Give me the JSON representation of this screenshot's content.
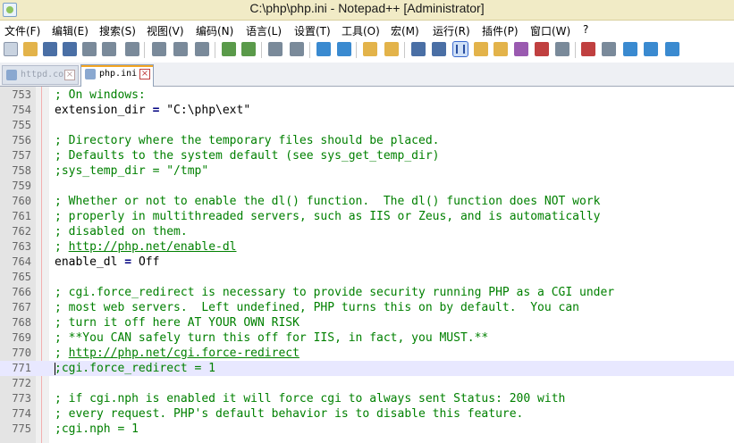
{
  "window": {
    "title": "C:\\php\\php.ini - Notepad++ [Administrator]"
  },
  "menu": [
    "文件(F)",
    "编辑(E)",
    "搜索(S)",
    "视图(V)",
    "编码(N)",
    "语言(L)",
    "设置(T)",
    "工具(O)",
    "宏(M)",
    "运行(R)",
    "插件(P)",
    "窗口(W)",
    "?"
  ],
  "tabs": [
    {
      "label": "httpd.conf",
      "active": false
    },
    {
      "label": "php.ini",
      "active": true
    }
  ],
  "icons": [
    "new-file-icon",
    "open-file-icon",
    "save-icon",
    "save-all-icon",
    "close-icon",
    "close-all-icon",
    "print-icon",
    "cut-icon",
    "copy-icon",
    "paste-icon",
    "undo-icon",
    "redo-icon",
    "find-icon",
    "replace-icon",
    "zoom-in-icon",
    "zoom-out-icon",
    "sync-vertical-icon",
    "sync-horizontal-icon",
    "word-wrap-icon",
    "show-all-chars-icon",
    "indent-guide-icon",
    "udl-icon",
    "doc-map-icon",
    "function-list-icon",
    "folder-workspace-icon",
    "monitor-icon",
    "record-macro-icon",
    "stop-macro-icon",
    "play-macro-icon",
    "run-macro-icon",
    "save-macro-icon"
  ],
  "editor": {
    "lines": [
      {
        "num": "753",
        "text": "; On windows:",
        "type": "comment"
      },
      {
        "num": "754",
        "key": "extension_dir",
        "op": "=",
        "value": "\"C:\\php\\ext\"",
        "type": "setting"
      },
      {
        "num": "755",
        "text": "",
        "type": "blank"
      },
      {
        "num": "756",
        "text": "; Directory where the temporary files should be placed.",
        "type": "comment"
      },
      {
        "num": "757",
        "text": "; Defaults to the system default (see sys_get_temp_dir)",
        "type": "comment"
      },
      {
        "num": "758",
        "text": ";sys_temp_dir = \"/tmp\"",
        "type": "comment"
      },
      {
        "num": "759",
        "text": "",
        "type": "blank"
      },
      {
        "num": "760",
        "text": "; Whether or not to enable the dl() function.  The dl() function does NOT work",
        "type": "comment"
      },
      {
        "num": "761",
        "text": "; properly in multithreaded servers, such as IIS or Zeus, and is automatically",
        "type": "comment"
      },
      {
        "num": "762",
        "text": "; disabled on them.",
        "type": "comment"
      },
      {
        "num": "763",
        "prefix": "; ",
        "url": "http://php.net/enable-dl",
        "type": "url"
      },
      {
        "num": "764",
        "key": "enable_dl",
        "op": "=",
        "value": "Off",
        "type": "setting"
      },
      {
        "num": "765",
        "text": "",
        "type": "blank"
      },
      {
        "num": "766",
        "text": "; cgi.force_redirect is necessary to provide security running PHP as a CGI under",
        "type": "comment"
      },
      {
        "num": "767",
        "text": "; most web servers.  Left undefined, PHP turns this on by default.  You can",
        "type": "comment"
      },
      {
        "num": "768",
        "text": "; turn it off here AT YOUR OWN RISK",
        "type": "comment"
      },
      {
        "num": "769",
        "text": "; **You CAN safely turn this off for IIS, in fact, you MUST.**",
        "type": "comment"
      },
      {
        "num": "770",
        "prefix": "; ",
        "url": "http://php.net/cgi.force-redirect",
        "type": "url"
      },
      {
        "num": "771",
        "text": ";cgi.force_redirect = 1",
        "type": "comment",
        "current": true
      },
      {
        "num": "772",
        "text": "",
        "type": "blank"
      },
      {
        "num": "773",
        "text": "; if cgi.nph is enabled it will force cgi to always sent Status: 200 with",
        "type": "comment"
      },
      {
        "num": "774",
        "text": "; every request. PHP's default behavior is to disable this feature.",
        "type": "comment"
      },
      {
        "num": "775",
        "text": ";cgi.nph = 1",
        "type": "comment"
      }
    ]
  }
}
